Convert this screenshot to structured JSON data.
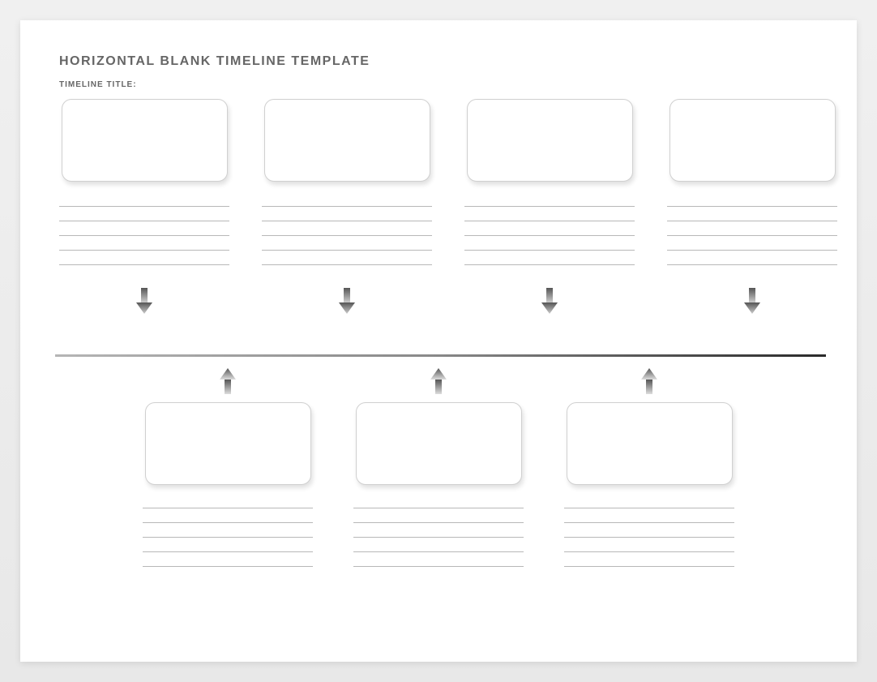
{
  "header": {
    "title": "HORIZONTAL BLANK TIMELINE TEMPLATE",
    "subtitle": "TIMELINE TITLE:"
  },
  "top_events": [
    {
      "box_content": "",
      "lines": [
        "",
        "",
        "",
        "",
        ""
      ]
    },
    {
      "box_content": "",
      "lines": [
        "",
        "",
        "",
        "",
        ""
      ]
    },
    {
      "box_content": "",
      "lines": [
        "",
        "",
        "",
        "",
        ""
      ]
    },
    {
      "box_content": "",
      "lines": [
        "",
        "",
        "",
        "",
        ""
      ]
    }
  ],
  "bottom_events": [
    {
      "box_content": "",
      "lines": [
        "",
        "",
        "",
        "",
        ""
      ]
    },
    {
      "box_content": "",
      "lines": [
        "",
        "",
        "",
        "",
        ""
      ]
    },
    {
      "box_content": "",
      "lines": [
        "",
        "",
        "",
        "",
        ""
      ]
    }
  ]
}
